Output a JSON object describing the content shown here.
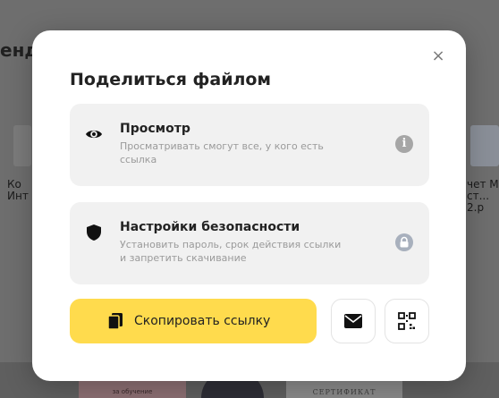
{
  "background": {
    "heading_fragment": "енд",
    "items": [
      {
        "line1": "Ко",
        "line2": "Инт"
      },
      {
        "line1": "чет М",
        "line2": "ст... 2.р"
      }
    ],
    "bottom_cards": [
      "за обучение",
      "СЕРТИФИКАТ"
    ]
  },
  "dialog": {
    "title": "Поделиться файлом",
    "close_glyph": "×",
    "options": [
      {
        "title": "Просмотр",
        "description": "Просматривать смогут все, у кого есть ссылка",
        "icon": "eye-icon",
        "badge_icon": "info-icon"
      },
      {
        "title": "Настройки безопасности",
        "description": "Установить пароль, срок действия ссылки и запретить скачивание",
        "icon": "shield-icon",
        "badge_icon": "lock-icon"
      }
    ],
    "copy_button_label": "Скопировать ссылку",
    "copy_icon": "copy-icon",
    "email_icon": "mail-icon",
    "qr_icon": "qr-code-icon",
    "accent_color": "#ffdb4d"
  }
}
